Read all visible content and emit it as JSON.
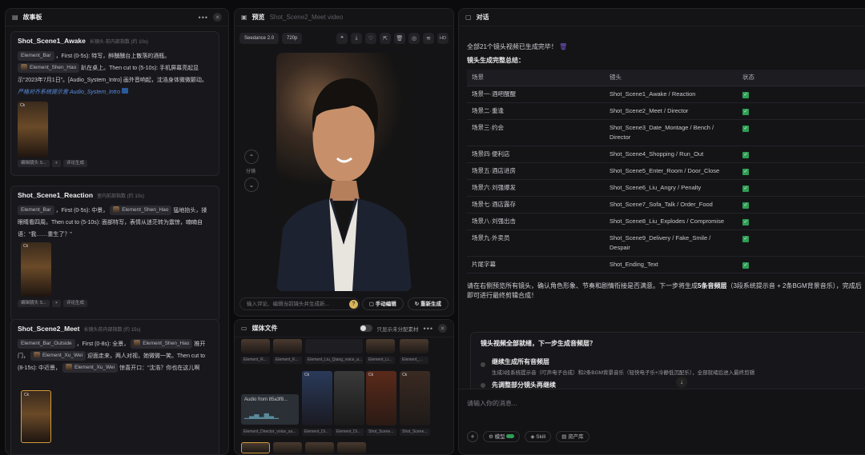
{
  "story": {
    "title": "故事板",
    "cards": [
      {
        "title": "Shot_Scene1_Awake",
        "meta": "长镜头·前内部指数 (约 10s)",
        "e1": "Element_Bar",
        "t1": "，First (0-5s): 特写，醉醺醺台上散落的酒瓶。",
        "e2": "Element_Shen_Hao",
        "t2": "趴在桌上。Then cut to (5-10s): 手机屏幕亮起显示“2023年7月1日”。[Audio_System_Intro] 画外音响起，沈浩身体微微颤动。",
        "hint": "严格对齐系统提示音 Audio_System_Intro",
        "b1": "编辑镜头 S...",
        "b2": "+",
        "b3": "评论生成"
      },
      {
        "title": "Shot_Scene1_Reaction",
        "meta": "室内前部指数 (约 10s)",
        "e1": "Element_Bar",
        "t1": "，First (0-5s): 中景，",
        "e2": "Element_Shen_Hao",
        "t2": "猛地抬头，揉眼睛看四周。Then cut to (5-10s): 面部特写，表情从迷茫转为震惊，喃喃自语：“我……重生了？”",
        "b1": "编辑镜头 S...",
        "b2": "+",
        "b3": "评论生成"
      },
      {
        "title": "Shot_Scene2_Meet",
        "meta": "长镜头前内部指数 (约 15s)",
        "e1": "Element_Bar_Outside",
        "t1": "，First (0-8s): 全景，",
        "e2": "Element_Shen_Hao",
        "t2": "推开门，",
        "e3": "Element_Xu_Wei",
        "t3": "迎面走来，两人对视，她微微一笑。Then cut to (8-15s): 中近景，",
        "e4": "Element_Xu_Wei",
        "t4": "惊喜开口：“沈浩？你也在这儿啊"
      }
    ]
  },
  "preview": {
    "title": "预览",
    "subtitle": "Shot_Scene2_Meet video",
    "model": "Seedance 2.0",
    "res": "720p",
    "hd": "HD",
    "nav": "分镜",
    "input_placeholder": "输入评论、编辑当前镜头并生成新...",
    "manual_btn": "手动编辑",
    "regen_btn": "重新生成"
  },
  "media": {
    "title": "媒体文件",
    "toggle_label": "只显示未分配素材",
    "labels": [
      "Element_R...",
      "Element_K...",
      "Element_Liu_Qiang_voice_a...",
      "Element_Li...",
      "Element_..."
    ],
    "audio": "Audio from 85a3f8...",
    "labels2": [
      "Element_Director_voice_sa...",
      "Element_Di...",
      "Element_Di...",
      "Shot_Scene...",
      "Shot_Scene..."
    ]
  },
  "chat": {
    "title": "对话",
    "done": "全部21个镜头视频已生成完毕！",
    "summary": "镜头生成完整总结：",
    "headers": [
      "场景",
      "镜头",
      "状态"
    ],
    "rows": [
      [
        "场景一·酒吧醒醒",
        "Shot_Scene1_Awake / Reaction"
      ],
      [
        "场景二·重逢",
        "Shot_Scene2_Meet / Director"
      ],
      [
        "场景三·约会",
        "Shot_Scene3_Date_Montage / Bench / Director"
      ],
      [
        "场景四·便利店",
        "Shot_Scene4_Shopping / Run_Out"
      ],
      [
        "场景五·酒店进房",
        "Shot_Scene5_Enter_Room / Door_Close"
      ],
      [
        "场景六·刘强爆发",
        "Shot_Scene6_Liu_Angry / Penalty"
      ],
      [
        "场景七·酒店露存",
        "Shot_Scene7_Sofa_Talk / Order_Food"
      ],
      [
        "场景八·刘强出击",
        "Shot_Scene8_Liu_Explodes / Compromise"
      ],
      [
        "场景九·外卖员",
        "Shot_Scene9_Delivery / Fake_Smile / Despair"
      ],
      [
        "片尾字幕",
        "Shot_Ending_Text"
      ]
    ],
    "after1": "请在右侧预览所有镜头，确认角色形象、节奏和剧情衔接是否满意。下一步将生成",
    "after_b": "5条音频层",
    "after2": "（3段系统提示音 + 2条BGM背景音乐），完成后即可进行最终剪辑合成！",
    "q_title": "镜头视频全部就绪，下一步生成音频层？",
    "opt1_t": "继续生成所有音频层",
    "opt1_d": "生成3段系统提示音（叮声电子合成）和2条BGM背景音乐（轻快电子乐+冷静低沉配乐），全部就绪后进入最终剪辑",
    "opt2_t": "先调整部分镜头再继续",
    "input_placeholder": "请输入你的消息...",
    "chips": [
      "模型",
      "Skill",
      "资产库"
    ]
  }
}
